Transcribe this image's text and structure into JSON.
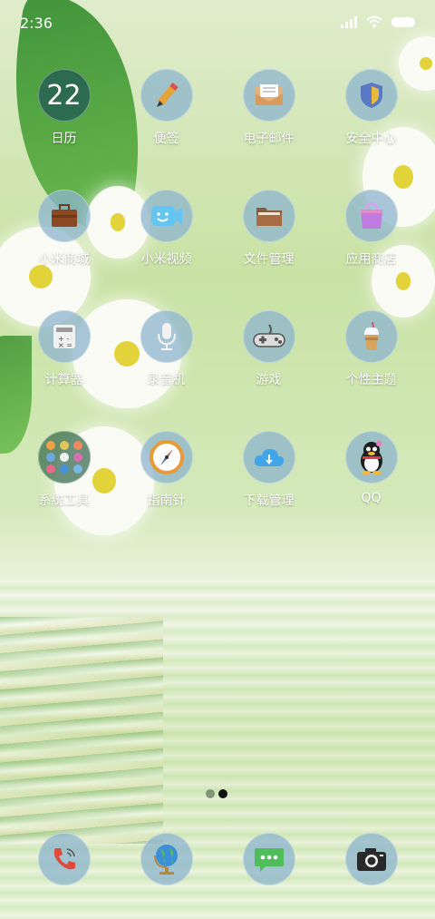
{
  "status_bar": {
    "time": "2:36"
  },
  "apps": [
    {
      "label": "日历",
      "icon": "calendar-icon",
      "calendar_day": "22"
    },
    {
      "label": "便签",
      "icon": "pencil-icon"
    },
    {
      "label": "电子邮件",
      "icon": "envelope-icon"
    },
    {
      "label": "安全中心",
      "icon": "shield-icon"
    },
    {
      "label": "小米商城",
      "icon": "briefcase-icon"
    },
    {
      "label": "小米视频",
      "icon": "video-camera-icon"
    },
    {
      "label": "文件管理",
      "icon": "folder-icon"
    },
    {
      "label": "应用商店",
      "icon": "shopping-bag-icon"
    },
    {
      "label": "计算器",
      "icon": "calculator-icon"
    },
    {
      "label": "录音机",
      "icon": "microphone-icon"
    },
    {
      "label": "游戏",
      "icon": "gamepad-icon"
    },
    {
      "label": "个性主题",
      "icon": "ice-cream-icon"
    },
    {
      "label": "系统工具",
      "icon": "folder-grid-icon"
    },
    {
      "label": "指南针",
      "icon": "compass-icon"
    },
    {
      "label": "下载管理",
      "icon": "cloud-download-icon"
    },
    {
      "label": "QQ",
      "icon": "penguin-icon"
    }
  ],
  "page_indicator": {
    "pages": 2,
    "current": 2
  },
  "dock": [
    {
      "icon": "phone-icon"
    },
    {
      "icon": "globe-icon"
    },
    {
      "icon": "chat-bubble-icon"
    },
    {
      "icon": "camera-icon"
    }
  ]
}
